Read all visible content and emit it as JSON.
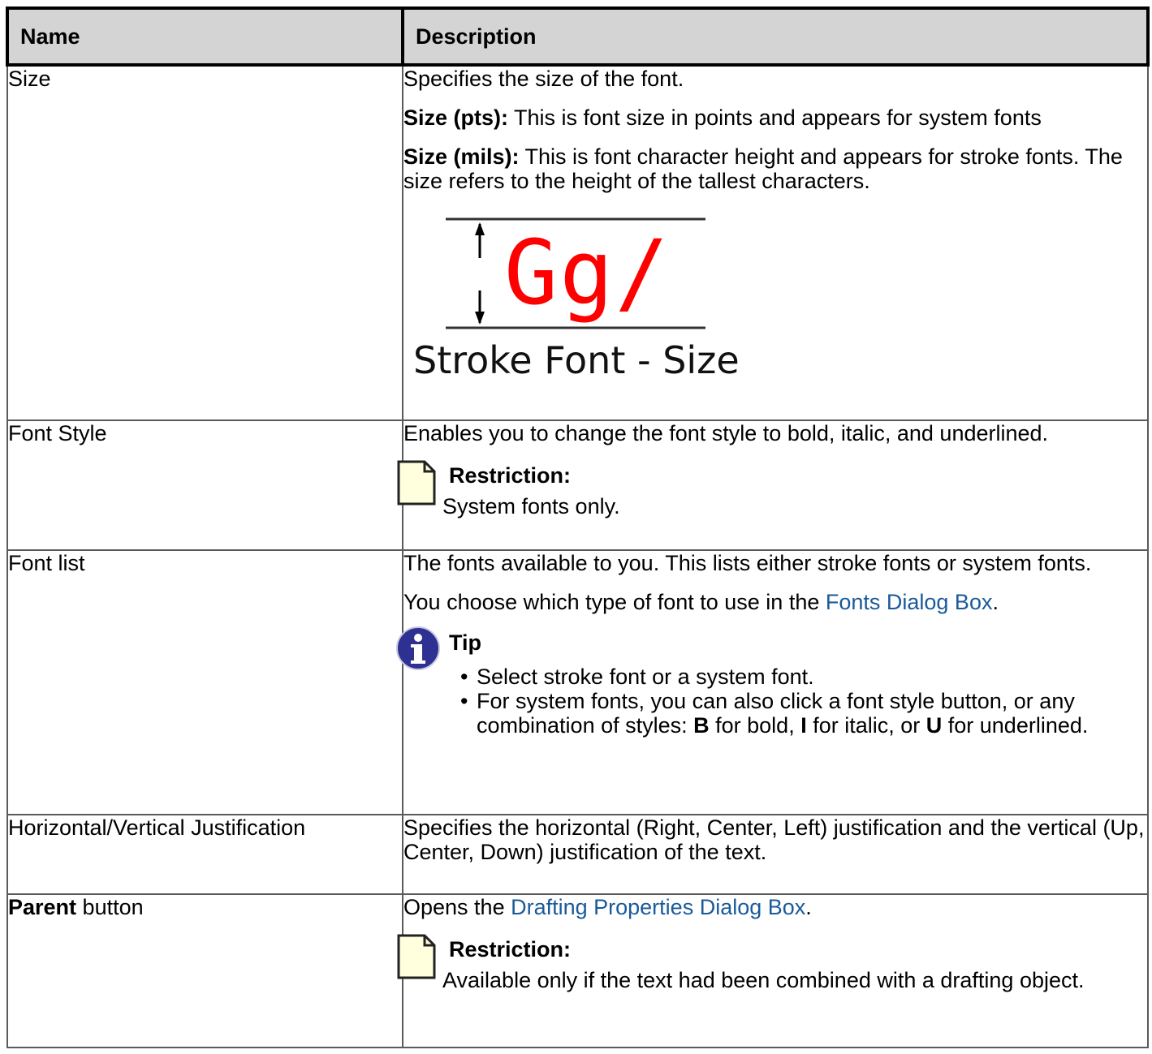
{
  "headers": {
    "name": "Name",
    "description": "Description"
  },
  "rows": {
    "size": {
      "name": "Size",
      "p1": "Specifies the size of the font.",
      "pts_label": "Size (pts):",
      "pts_text": " This is font size in points and appears for system fonts",
      "mils_label": "Size (mils):",
      "mils_text": " This is font character height and appears for stroke fonts. The size refers to the height of the tallest characters.",
      "figure": {
        "glyphs": "Gg/",
        "caption": "Stroke Font - Size",
        "glyph_color": "#ff0000"
      }
    },
    "font_style": {
      "name": "Font Style",
      "p1": "Enables you to change the font style to bold, italic, and underlined.",
      "note_title": "Restriction:",
      "note_body": "System fonts only.",
      "note_icon": "note-page-icon"
    },
    "font_list": {
      "name": "Font list",
      "p1": "The fonts available to you. This lists either stroke fonts or system fonts.",
      "p2_before": "You choose which type of font to use in the ",
      "p2_link": "Fonts Dialog Box",
      "p2_after": ".",
      "tip_title": "Tip",
      "tip_icon": "info-icon",
      "tip_item1": "Select stroke font or a system font.",
      "tip_item2_a": "For system fonts, you can also click a font style button, or any combination of styles: ",
      "tip_item2_b": "B",
      "tip_item2_c": " for bold, ",
      "tip_item2_d": "I",
      "tip_item2_e": " for italic, or ",
      "tip_item2_f": "U",
      "tip_item2_g": " for underlined."
    },
    "justification": {
      "name": "Horizontal/Vertical Justification",
      "p1": "Specifies the horizontal (Right, Center, Left) justification and the vertical (Up, Center, Down) justification of the text."
    },
    "parent": {
      "name_bold": "Parent",
      "name_rest": " button",
      "p1_before": "Opens the ",
      "p1_link": "Drafting Properties Dialog Box",
      "p1_after": ".",
      "note_title": "Restriction:",
      "note_body": "Available only if the text had been combined with a drafting object.",
      "note_icon": "note-page-icon"
    }
  },
  "colors": {
    "header_bg": "#d4d4d4",
    "link": "#1a5a99",
    "note_icon_fill": "#ffffdd",
    "info_icon_fill": "#2e3192"
  }
}
